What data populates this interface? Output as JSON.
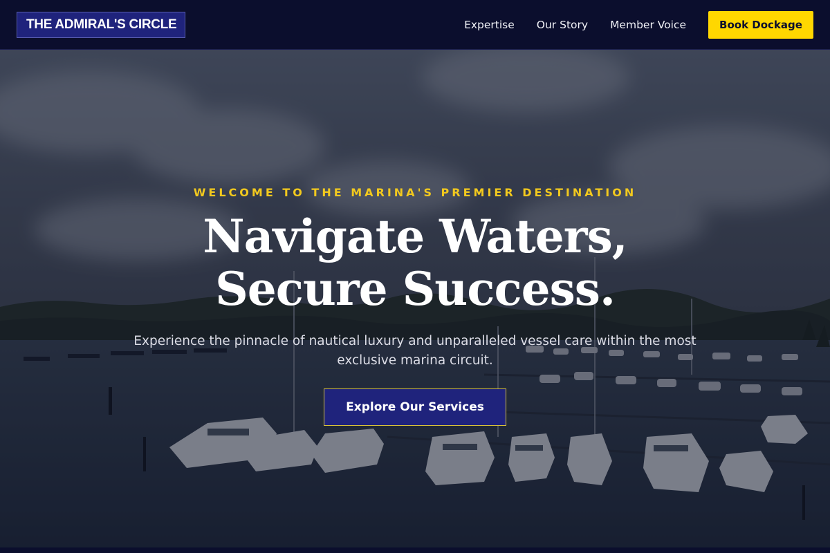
{
  "header": {
    "logo_text": "THE ADMIRAL'S CIRCLE",
    "nav_links": [
      "Expertise",
      "Our Story",
      "Member Voice"
    ],
    "cta_label": "Book Dockage"
  },
  "hero": {
    "eyebrow": "WELCOME TO THE MARINA'S PREMIER DESTINATION",
    "title": "Navigate Waters, Secure Success.",
    "subtitle": "Experience the pinnacle of nautical luxury and unparalleled vessel care within the most exclusive marina circuit.",
    "button_label": "Explore Our Services",
    "background_image": "marina-with-docked-yachts-photo"
  },
  "colors": {
    "navy": "#0b0e2d",
    "indigo": "#1f237c",
    "gold": "#ffd700",
    "accent_gold": "#f2c91e"
  }
}
